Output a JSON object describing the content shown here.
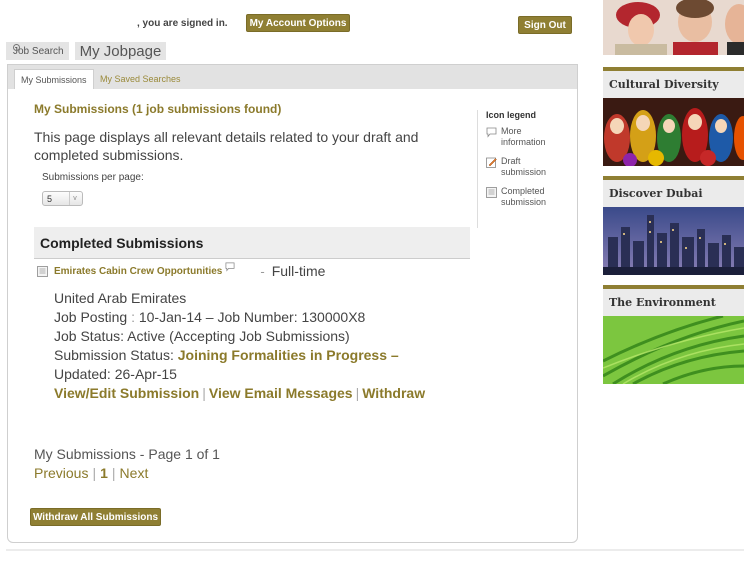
{
  "header": {
    "signed_in_text": ", you are signed in.",
    "account_button": "My Account Options",
    "signout_button": "Sign Out"
  },
  "top_tabs": {
    "job_search": "Job Search",
    "my_jobpage": "My Jobpage"
  },
  "sub_tabs": {
    "my_submissions": "My Submissions",
    "my_saved_searches": "My Saved Searches"
  },
  "main": {
    "title": "My Submissions (1 job submissions found)",
    "description": "This page displays all relevant details related to your draft and completed submissions.",
    "per_page_label": "Submissions per page:",
    "per_page_value": "5",
    "per_page_arrow": "v"
  },
  "legend": {
    "title": "Icon legend",
    "items": [
      {
        "icon": "speech-bubble-icon",
        "label": "More information"
      },
      {
        "icon": "pencil-note-icon",
        "label": "Draft submission"
      },
      {
        "icon": "document-icon",
        "label": "Completed submission"
      }
    ]
  },
  "completed": {
    "header": "Completed Submissions",
    "job": {
      "title": "Emirates Cabin Crew Opportunities",
      "separator": "-",
      "type": "Full-time",
      "location": "United Arab Emirates",
      "posting_label": "Job Posting",
      "posting_colon": ":",
      "posting_value": "10-Jan-14 – Job Number: 130000X8",
      "status": "Job Status: Active (Accepting Job Submissions)",
      "submission_status_label": "Submission Status:",
      "submission_status_value": "Joining Formalities in Progress –",
      "updated": "Updated: 26-Apr-15",
      "actions": {
        "view_edit": "View/Edit Submission",
        "email": "View Email Messages",
        "withdraw": "Withdraw",
        "pipe": "|"
      }
    }
  },
  "paging": {
    "summary": "My Submissions - Page 1 of 1",
    "previous": "Previous",
    "current": "1",
    "next": "Next",
    "pipe": "|"
  },
  "withdraw_all_button": "Withdraw All Submissions",
  "sidebar": {
    "promos": [
      {
        "title": "Cultural Diversity"
      },
      {
        "title": "Discover Dubai"
      },
      {
        "title": "The Environment"
      }
    ]
  },
  "colors": {
    "accent": "#8f7f33",
    "accent_text": "#8b7a2b"
  }
}
